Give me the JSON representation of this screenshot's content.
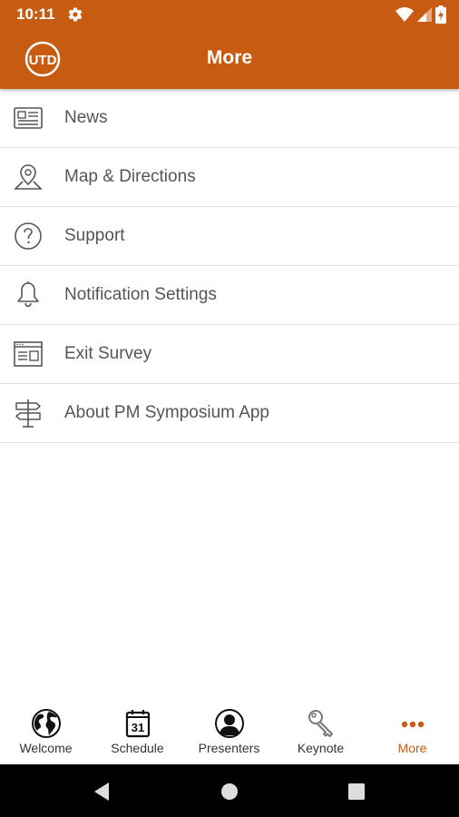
{
  "status_bar": {
    "time": "10:11"
  },
  "header": {
    "title": "More",
    "logo_text": "UTD"
  },
  "menu": {
    "items": [
      {
        "label": "News",
        "icon": "newspaper-icon"
      },
      {
        "label": "Map & Directions",
        "icon": "map-pin-icon"
      },
      {
        "label": "Support",
        "icon": "question-circle-icon"
      },
      {
        "label": "Notification Settings",
        "icon": "bell-icon"
      },
      {
        "label": "Exit Survey",
        "icon": "survey-form-icon"
      },
      {
        "label": "About PM Symposium App",
        "icon": "signpost-icon"
      }
    ]
  },
  "bottom_nav": {
    "items": [
      {
        "label": "Welcome",
        "icon": "globe-icon",
        "active": false
      },
      {
        "label": "Schedule",
        "icon": "calendar-icon",
        "active": false
      },
      {
        "label": "Presenters",
        "icon": "person-icon",
        "active": false
      },
      {
        "label": "Keynote",
        "icon": "key-icon",
        "active": false
      },
      {
        "label": "More",
        "icon": "more-dots-icon",
        "active": true
      }
    ],
    "calendar_day": "31"
  },
  "colors": {
    "brand": "#c75b12",
    "text": "#555555",
    "divider": "#e0e0e0"
  }
}
